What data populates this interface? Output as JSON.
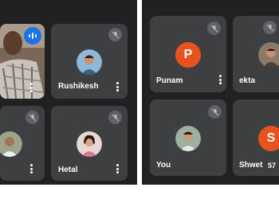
{
  "left_panel": {
    "tiles": [
      {
        "name": "",
        "state": "speaking"
      },
      {
        "name": "Rushikesh",
        "state": "normal"
      },
      {
        "name": "",
        "state": "muted"
      },
      {
        "name": "Hetal",
        "state": "muted"
      }
    ]
  },
  "right_panel": {
    "tiles": [
      {
        "name": "Punam",
        "avatar_letter": "P",
        "avatar_color": "#e8531c",
        "state": "muted"
      },
      {
        "name": "ekta",
        "state": "muted"
      },
      {
        "name": "You",
        "state": "muted"
      },
      {
        "name": "Shwet",
        "avatar_letter": "S",
        "avatar_color": "#e8531c",
        "state": "normal",
        "timer": "57"
      }
    ]
  },
  "colors": {
    "panel_bg": "#202124",
    "tile_bg": "#3c4043",
    "mute_bg": "#5f6368",
    "speaking_bg": "#1a73e8",
    "avatar_orange": "#e8531c"
  }
}
